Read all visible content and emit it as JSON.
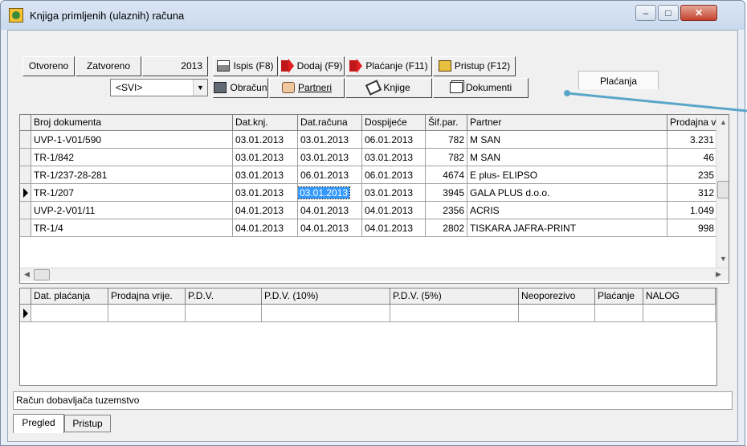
{
  "window": {
    "title": "Knjiga primljenih (ulaznih) računa",
    "buttons": {
      "minimize": "‒",
      "maximize": "□",
      "close": "✕"
    }
  },
  "toolbar": {
    "otvoreno": "Otvoreno",
    "zatvoreno": "Zatvoreno",
    "year": "2013",
    "ispis": "Ispis (F8)",
    "dodaj": "Dodaj (F9)",
    "placanje_btn": "Plaćanje (F11)",
    "pristup_btn": "Pristup (F12)",
    "obracun": "Obračun",
    "partneri": "Partneri",
    "knjige": "Knjige",
    "dokumenti": "Dokumenti",
    "placanja_tab": "Plaćanja",
    "filter_value": "<SVI>"
  },
  "main_grid": {
    "columns": [
      "Broj dokumenta",
      "Dat.knj.",
      "Dat.računa",
      "Dospijeće",
      "Šif.par.",
      "Partner",
      "Prodajna v"
    ],
    "rows": [
      [
        "UVP-1-V01/590",
        "03.01.2013",
        "03.01.2013",
        "06.01.2013",
        "782",
        "M SAN",
        "3.231"
      ],
      [
        "TR-1/842",
        "03.01.2013",
        "03.01.2013",
        "03.01.2013",
        "782",
        "M SAN",
        "46"
      ],
      [
        "TR-1/237-28-281",
        "03.01.2013",
        "06.01.2013",
        "06.01.2013",
        "4674",
        "E plus- ELIPSO",
        "235"
      ],
      [
        "TR-1/207",
        "03.01.2013",
        "03.01.2013",
        "03.01.2013",
        "3945",
        "GALA PLUS d.o.o.",
        "312"
      ],
      [
        "UVP-2-V01/11",
        "04.01.2013",
        "04.01.2013",
        "04.01.2013",
        "2356",
        "ACRIS",
        "1.049"
      ],
      [
        "TR-1/4",
        "04.01.2013",
        "04.01.2013",
        "04.01.2013",
        "2802",
        "TISKARA JAFRA-PRINT",
        "998"
      ]
    ]
  },
  "payment_grid": {
    "columns": [
      "Dat. plaćanja",
      "Prodajna vrije.",
      "P.D.V.",
      "P.D.V. (10%)",
      "P.D.V. (5%)",
      "Neoporezivo",
      "Plaćanje",
      "NALOG"
    ]
  },
  "status_text": "Račun dobavljača tuzemstvo",
  "bottom_tabs": [
    "Pregled",
    "Pristup"
  ],
  "colors": {
    "selection": "#3399ff",
    "callout": "#5aa6c8"
  }
}
